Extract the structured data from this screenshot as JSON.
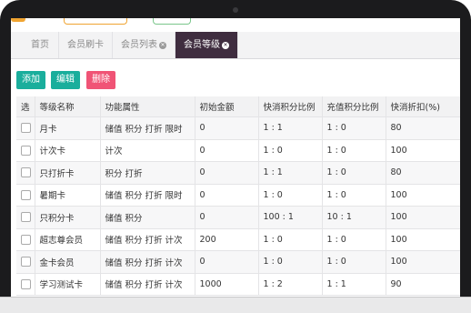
{
  "tabs": [
    {
      "label": "首页",
      "closable": false,
      "active": false
    },
    {
      "label": "会员刷卡",
      "closable": false,
      "active": false
    },
    {
      "label": "会员列表",
      "closable": true,
      "active": false
    },
    {
      "label": "会员等级",
      "closable": true,
      "active": true
    }
  ],
  "toolbar": {
    "add_label": "添加",
    "edit_label": "编辑",
    "delete_label": "删除"
  },
  "table": {
    "headers": [
      "选",
      "等级名称",
      "功能属性",
      "初始金额",
      "快消积分比例",
      "充值积分比例",
      "快消折扣(%)"
    ],
    "rows": [
      [
        "",
        "月卡",
        "储值 积分 打折 限时",
        "0",
        "1 : 1",
        "1 : 0",
        "80"
      ],
      [
        "",
        "计次卡",
        "计次",
        "0",
        "1 : 0",
        "1 : 0",
        "100"
      ],
      [
        "",
        "只打折卡",
        "积分 打折",
        "0",
        "1 : 1",
        "1 : 0",
        "80"
      ],
      [
        "",
        "暑期卡",
        "储值 积分 打折 限时",
        "0",
        "1 : 0",
        "1 : 0",
        "100"
      ],
      [
        "",
        "只积分卡",
        "储值 积分",
        "0",
        "100 : 1",
        "10 : 1",
        "100"
      ],
      [
        "",
        "超志尊会员",
        "储值 积分 打折 计次",
        "200",
        "1 : 0",
        "1 : 0",
        "100"
      ],
      [
        "",
        "金卡会员",
        "储值 积分 打折 计次",
        "0",
        "1 : 0",
        "1 : 0",
        "100"
      ],
      [
        "",
        "学习测试卡",
        "储值 积分 打折 计次",
        "1000",
        "1 : 2",
        "1 : 1",
        "90"
      ]
    ]
  },
  "colors": {
    "accent_active_tab": "#3f2d3f",
    "button_teal": "#1aae9c",
    "button_pink": "#f05476",
    "bezel": "#1b1b1d"
  }
}
